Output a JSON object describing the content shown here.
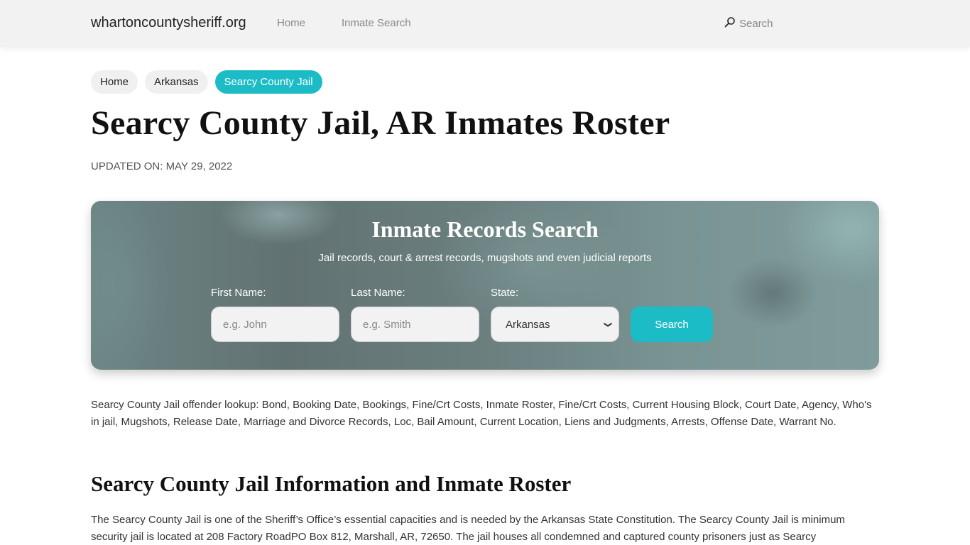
{
  "navbar": {
    "brand": "whartoncountysheriff.org",
    "links": [
      "Home",
      "Inmate Search"
    ],
    "search_label": "Search",
    "search_icon": "search-icon"
  },
  "breadcrumb": [
    {
      "label": "Home",
      "active": false
    },
    {
      "label": "Arkansas",
      "active": false
    },
    {
      "label": "Searcy County Jail",
      "active": true
    }
  ],
  "page": {
    "title": "Searcy County Jail, AR Inmates Roster",
    "updated": "UPDATED ON: MAY 29, 2022"
  },
  "search_card": {
    "title": "Inmate Records Search",
    "subtitle": "Jail records, court & arrest records, mugshots and even judicial reports",
    "first_name_label": "First Name:",
    "first_name_placeholder": "e.g. John",
    "first_name_value": "",
    "last_name_label": "Last Name:",
    "last_name_placeholder": "e.g. Smith",
    "last_name_value": "",
    "state_label": "State:",
    "state_selected": "Arkansas",
    "button_label": "Search",
    "accent_color": "#1cbcc7"
  },
  "content": {
    "lookup_paragraph": "Searcy County Jail offender lookup: Bond, Booking Date, Bookings, Fine/Crt Costs, Inmate Roster, Fine/Crt Costs, Current Housing Block, Court Date, Agency, Who's in jail, Mugshots, Release Date, Marriage and Divorce Records, Loc, Bail Amount, Current Location, Liens and Judgments, Arrests, Offense Date, Warrant No.",
    "section_title": "Searcy County Jail Information and Inmate Roster",
    "info_paragraph": "The Searcy County Jail is one of the Sheriff’s Office’s essential capacities and is needed by the Arkansas State Constitution. The Searcy County Jail is minimum security jail is located at 208 Factory RoadPO Box 812, Marshall, AR, 72650. The jail houses all condemned and captured county prisoners just as Searcy"
  }
}
